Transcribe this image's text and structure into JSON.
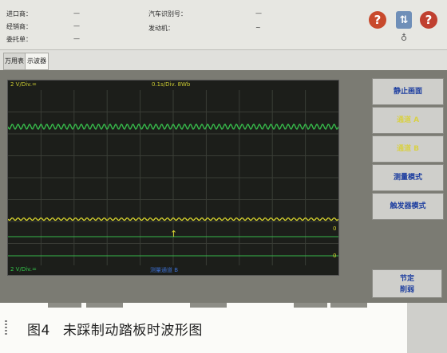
{
  "header": {
    "left_fields": [
      {
        "label": "进口商：",
        "value": "—"
      },
      {
        "label": "经销商：",
        "value": "—"
      },
      {
        "label": "委托单：",
        "value": "—"
      }
    ],
    "right_fields": [
      {
        "label": "汽车识别号：",
        "value": "—"
      },
      {
        "label": "发动机：",
        "value": "~"
      }
    ],
    "tools": {
      "help": "?",
      "connection": "⇅",
      "close": "?",
      "mic": "♁"
    }
  },
  "tabs": [
    {
      "label": "万用表",
      "active": false
    },
    {
      "label": "示波器",
      "active": true
    }
  ],
  "scope": {
    "top_left": "2 V/Div.=",
    "top_mid": "0.1s/Div. 8Wb",
    "bottom_left": "2 V/Div.=",
    "bottom_mid": "测量通道 B",
    "right_marker_a": "0",
    "right_marker_b": "0",
    "trigger_arrow": "↑",
    "colors": {
      "green": "#36b84a",
      "yellow": "#d8d42e",
      "grid": "#3a3d36",
      "blue_label": "#3c6fd0"
    }
  },
  "side_buttons": [
    {
      "label": "静止画面",
      "style": "blue"
    },
    {
      "label": "通道 A",
      "style": "yel"
    },
    {
      "label": "通道 B",
      "style": "yel"
    },
    {
      "label": "测量模式",
      "style": "blue"
    },
    {
      "label": "触发器模式",
      "style": "blue"
    }
  ],
  "lock_button": {
    "line1": "节定",
    "line2": "削弱"
  },
  "caption": {
    "figure_number": "图4",
    "text": "未踩制动踏板时波形图"
  }
}
